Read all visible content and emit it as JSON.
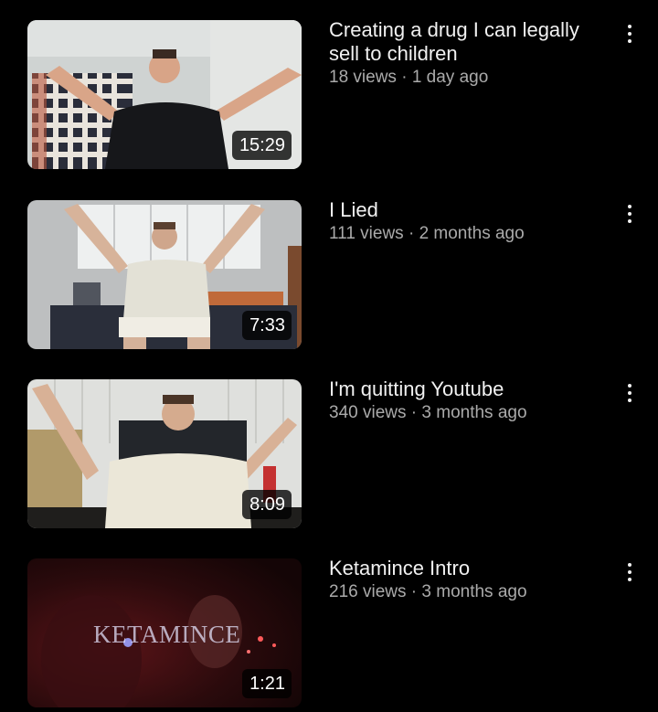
{
  "videos": [
    {
      "title": "Creating a drug I can legally sell to children",
      "views": "18 views",
      "age": "1 day ago",
      "duration": "15:29"
    },
    {
      "title": "I Lied",
      "views": "111 views",
      "age": "2 months ago",
      "duration": "7:33"
    },
    {
      "title": "I'm quitting Youtube",
      "views": "340 views",
      "age": "3 months ago",
      "duration": "8:09"
    },
    {
      "title": "Ketamince Intro",
      "views": "216 views",
      "age": "3 months ago",
      "duration": "1:21",
      "thumbnail_text": "KETAMINCE"
    }
  ],
  "separator": " · ",
  "icons": {
    "more": "more-vert-icon"
  },
  "colors": {
    "background": "#000000",
    "title": "#f1f1f1",
    "subtext": "#aaaaaa"
  }
}
